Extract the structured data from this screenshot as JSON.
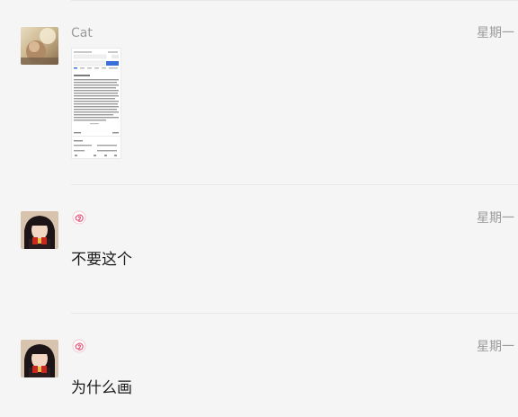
{
  "messages": [
    {
      "sender": "Cat",
      "time": "星期一",
      "type": "image",
      "avatar_icon": "cat-photo-avatar"
    },
    {
      "sender": "",
      "time": "星期一",
      "type": "text",
      "text": "不要这个",
      "avatar_icon": "girl-photo-avatar",
      "name_icon": "swirl-icon"
    },
    {
      "sender": "",
      "time": "星期一",
      "type": "text",
      "text": "为什么画",
      "avatar_icon": "girl-photo-avatar",
      "name_icon": "swirl-icon"
    }
  ],
  "colors": {
    "background": "#f5f5f5",
    "meta_text": "#9b9b9b",
    "body_text": "#1a1a1a",
    "accent_blue": "#3b6fd8",
    "swirl_pink": "#e4587a"
  }
}
